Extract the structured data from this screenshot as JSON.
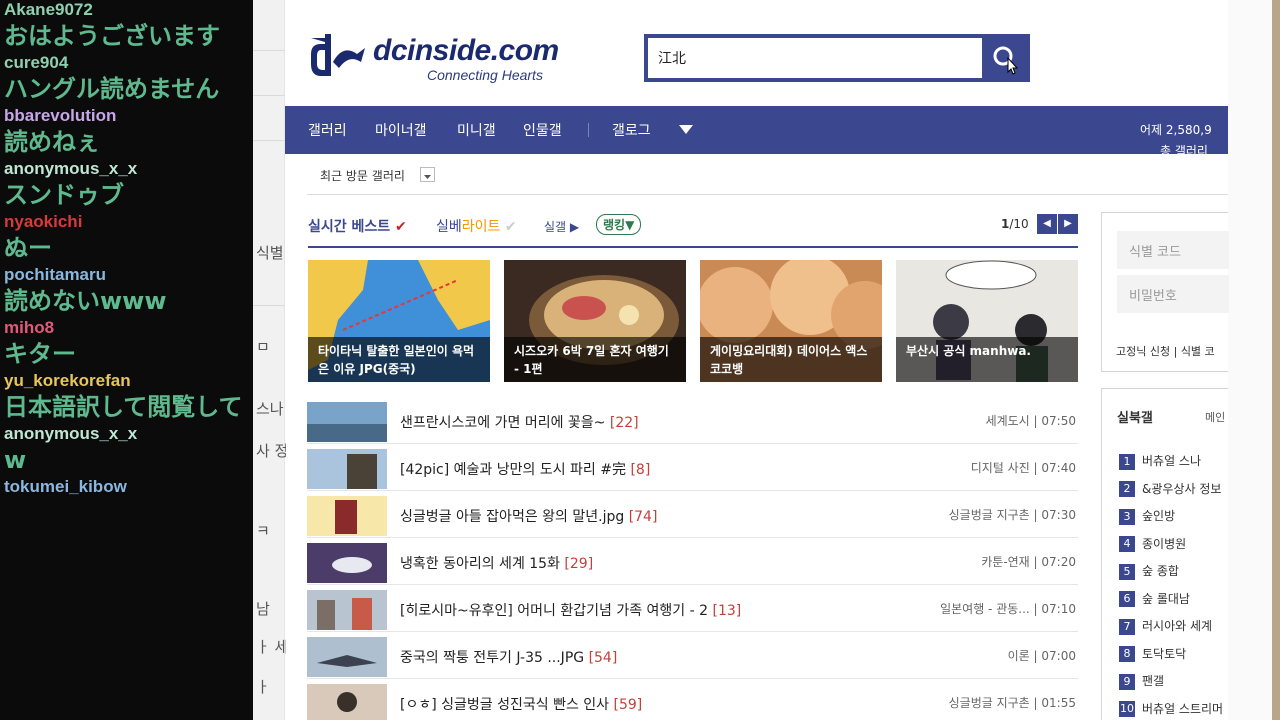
{
  "chat": {
    "messages": [
      {
        "user": "Akane9072",
        "text": "おはようございます",
        "color": "#8fd0b0"
      },
      {
        "user": "cure904",
        "text": "ハングル読めません",
        "color": "#8fd0b0"
      },
      {
        "user": "bbarevolution",
        "text": "読めねぇ",
        "color": "#c7a7e8"
      },
      {
        "user": "anonymous_x_x",
        "text": "スンドゥブ",
        "color": "#bfe7d3"
      },
      {
        "user": "nyaokichi",
        "text": "ぬー",
        "color": "#d63a3a"
      },
      {
        "user": "pochitamaru",
        "text": "読めないwww",
        "color": "#8ab7e0"
      },
      {
        "user": "miho8",
        "text": "キター",
        "color": "#e05a7a"
      },
      {
        "user": "yu_korekorefan",
        "text": "日本語訳して閲覧して",
        "color": "#e6c65a"
      },
      {
        "user": "anonymous_x_x",
        "text": "w",
        "color": "#bfe7d3"
      },
      {
        "user": "tokumei_kibow",
        "text": "",
        "color": "#8ab7e0"
      }
    ]
  },
  "left_strip": {
    "items": [
      "식별",
      "ㅁ",
      "스나",
      "사 정",
      "ㅋ",
      "남",
      "ㅏ 세",
      "ㅏ"
    ]
  },
  "header": {
    "logo_text": "dcinside.com",
    "logo_sub": "Connecting Hearts",
    "search_value": "江北",
    "brand_color": "#3b4890"
  },
  "nav": {
    "items": [
      "갤러리",
      "마이너갤",
      "미니갤",
      "인물갤",
      "갤로그"
    ],
    "right_1": "어제 2,580,9",
    "right_2": "총 갤러리"
  },
  "recent": {
    "label": "최근 방문 갤러리"
  },
  "best": {
    "tab_best": "실시간 베스트",
    "tab_live_a": "실베",
    "tab_live_b": "라이트",
    "tab_sil": "실갤",
    "tab_rank": "랭킹",
    "page_current": "1",
    "page_total": "/10",
    "thumbs": [
      {
        "title": "타이타닉 탈출한 일본인이 욕먹은 이유 JPG(중국)"
      },
      {
        "title": "시즈오카 6박 7일 혼자 여행기 - 1편"
      },
      {
        "title": "게이밍요리대회) 데이어스 액스 코코뱅"
      },
      {
        "title": "부산시 공식 manhwa."
      }
    ]
  },
  "posts": [
    {
      "title": "샌프란시스코에 가면 머리에 꽃을~",
      "count": "[22]",
      "gallery": "세계도시",
      "time": "07:50"
    },
    {
      "title": "[42pic] 예술과 낭만의 도시 파리 #完",
      "count": "[8]",
      "gallery": "디지털 사진",
      "time": "07:40"
    },
    {
      "title": "싱글벙글 아들 잡아먹은 왕의 말년.jpg",
      "count": "[74]",
      "gallery": "싱글벙글 지구촌",
      "time": "07:30"
    },
    {
      "title": "냉혹한 동아리의 세계 15화",
      "count": "[29]",
      "gallery": "카툰-연재",
      "time": "07:20"
    },
    {
      "title": "[히로시마~유후인] 어머니 환갑기념 가족 여행기 - 2",
      "count": "[13]",
      "gallery": "일본여행 - 관동...",
      "time": "07:10"
    },
    {
      "title": "중국의 짝퉁 전투기 J-35 ...JPG",
      "count": "[54]",
      "gallery": "이론",
      "time": "07:00"
    },
    {
      "title": "[ㅇㅎ] 싱글벙글 성진국식 빤스 인사",
      "count": "[59]",
      "gallery": "싱글벙글 지구촌",
      "time": "01:55"
    }
  ],
  "login": {
    "id_placeholder": "식별 코드",
    "pw_placeholder": "비밀번호",
    "link_1": "고정닉 신청",
    "link_2": "식별 코"
  },
  "ranking": {
    "title": "실북갤",
    "sub": "메인",
    "items": [
      "버츄얼 스나",
      "&광우상사 정보",
      "숲인방",
      "종이병원",
      "숲 종합",
      "숲 롤대남",
      "러시아와 세계",
      "토닥토닥",
      "팬갤",
      "버츄얼 스트리머"
    ]
  }
}
